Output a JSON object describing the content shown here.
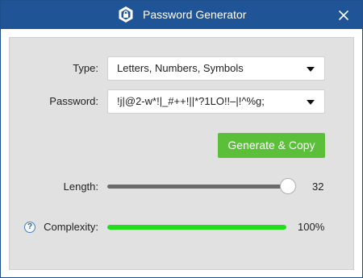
{
  "window": {
    "title": "Password Generator",
    "accent_color": "#1f5597",
    "app_icon": "shield-lock-icon",
    "close_icon": "close-icon"
  },
  "form": {
    "type_label": "Type:",
    "type_value": "Letters, Numbers, Symbols",
    "password_label": "Password:",
    "password_value": "!j|@2-w*!|_#++!||*?1LO!!–|!^%g;",
    "generate_button_label": "Generate & Copy",
    "generate_button_color": "#5cbf3a",
    "length_label": "Length:",
    "length_value": "32",
    "complexity_label": "Complexity:",
    "complexity_value": "100%",
    "complexity_fraction": 1.0,
    "complexity_color": "#22dd1b",
    "help_icon": "question-icon"
  }
}
